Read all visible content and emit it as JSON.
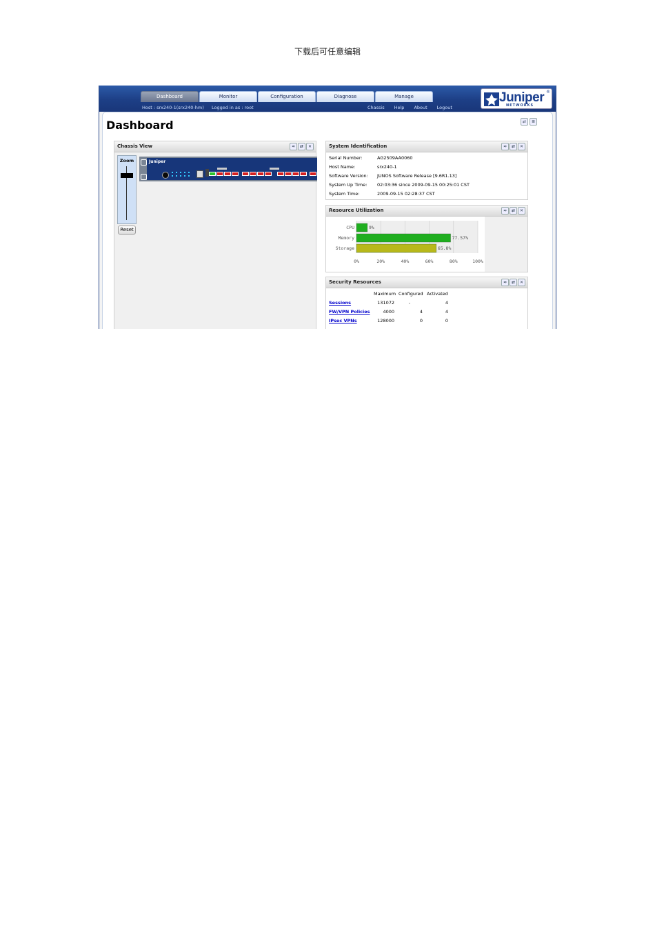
{
  "doc_header": "下载后可任意编辑",
  "nav": {
    "tabs": [
      "Dashboard",
      "Monitor",
      "Configuration",
      "Diagnose",
      "Manage"
    ],
    "active_tab": "Dashboard",
    "host_text": "Host : srx240-1(srx240-hm)",
    "logged_in_text": "Logged in as : root",
    "links": [
      "Chassis",
      "Help",
      "About",
      "Logout"
    ]
  },
  "logo": {
    "word": "Juniper",
    "sub": "NETWORKS",
    "reg": "®"
  },
  "page": {
    "title": "Dashboard"
  },
  "chassis": {
    "title": "Chassis View",
    "zoom_label": "Zoom",
    "reset_label": "Reset",
    "device_brand": "Juniper"
  },
  "system_id": {
    "title": "System Identification",
    "rows": [
      {
        "key": "Serial Number:",
        "value": "AG2509AA0060"
      },
      {
        "key": "Host Name:",
        "value": "srx240-1"
      },
      {
        "key": "Software Version:",
        "value": "JUNOS Software Release [9.6R1.13]"
      },
      {
        "key": "System Up Time:",
        "value": "02:03:36 since 2009-09-15 00:25:01 CST"
      },
      {
        "key": "System Time:",
        "value": "2009-09-15 02:28:37 CST"
      }
    ]
  },
  "resource": {
    "title": "Resource Utilization"
  },
  "chart_data": {
    "type": "bar",
    "orientation": "horizontal",
    "categories": [
      "CPU",
      "Memory",
      "Storage"
    ],
    "values": [
      9,
      77.57,
      65.8
    ],
    "value_labels": [
      "9%",
      "77.57%",
      "65.8%"
    ],
    "xlim": [
      0,
      100
    ],
    "x_ticks": [
      "0%",
      "20%",
      "40%",
      "60%",
      "80%",
      "100%"
    ],
    "colors": [
      "#1fae1f",
      "#1fae1f",
      "#b8b81a"
    ],
    "grid": true
  },
  "security": {
    "title": "Security Resources",
    "headers": [
      "Maximum",
      "Configured",
      "Activated"
    ],
    "rows": [
      {
        "name": "Sessions",
        "max": "131072",
        "configured": "-",
        "activated": "4"
      },
      {
        "name": "FW/VPN Policies",
        "max": "4000",
        "configured": "4",
        "activated": "4"
      },
      {
        "name": "IPsec VPNs",
        "max": "128000",
        "configured": "0",
        "activated": "0"
      }
    ]
  },
  "panel_tool_glyphs": [
    "≈",
    "⇄",
    "✕"
  ],
  "top_tool_glyphs": [
    "⇄",
    "≣"
  ]
}
